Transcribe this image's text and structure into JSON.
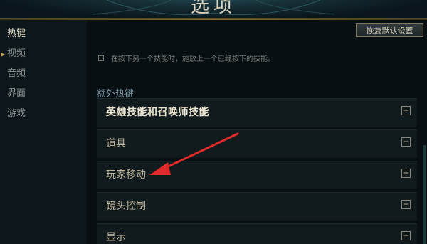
{
  "window": {
    "title": "选项"
  },
  "sidebar": {
    "items": [
      {
        "label": "热键",
        "active": true
      },
      {
        "label": "视频",
        "active": false
      },
      {
        "label": "音频",
        "active": false
      },
      {
        "label": "界面",
        "active": false
      },
      {
        "label": "游戏",
        "active": false
      }
    ]
  },
  "main": {
    "restore_defaults_label": "恢复默认设置",
    "checkbox_label": "在按下另一个技能时，施放上一个已经按下的技能。",
    "checkbox_checked": false,
    "section_title": "额外热键",
    "rows": [
      {
        "label": "英雄技能和召唤师技能",
        "expand_symbol": "+"
      },
      {
        "label": "道具",
        "expand_symbol": "+"
      },
      {
        "label": "玩家移动",
        "expand_symbol": "+"
      },
      {
        "label": "镜头控制",
        "expand_symbol": "+"
      },
      {
        "label": "显示",
        "expand_symbol": "+"
      }
    ]
  },
  "annotation": {
    "arrow_color": "#e02b2b"
  }
}
